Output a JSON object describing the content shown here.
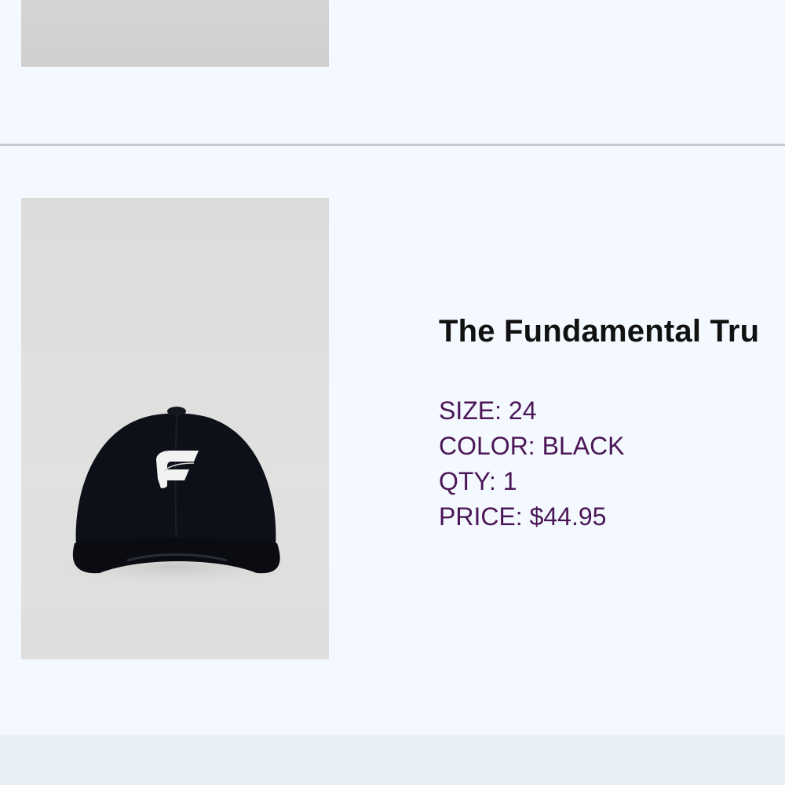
{
  "previous_item": {
    "image_alt": "product photo (cropped)"
  },
  "cart_item": {
    "image_icon": "black-baseball-cap-with-white-f-logo",
    "title": "The Fundamental Tru",
    "attributes": {
      "size": "SIZE: 24",
      "color": "COLOR: BLACK",
      "qty": "QTY: 1",
      "price": "PRICE: $44.95"
    }
  },
  "colors": {
    "background": "#f4f8ff",
    "divider": "#c7c7c9",
    "attribute_text": "#4b1656",
    "title_text": "#111111",
    "footer": "#e9eff7"
  }
}
